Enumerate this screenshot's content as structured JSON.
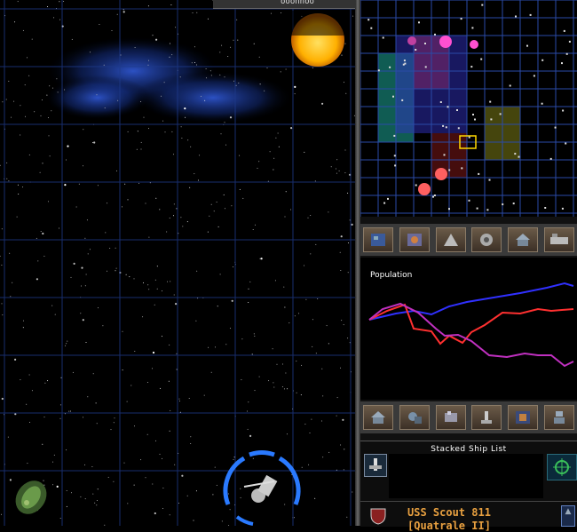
{
  "top_bar": {
    "clipped_text": "ooonnoo"
  },
  "graph": {
    "title": "Population"
  },
  "stack": {
    "title": "Stacked  Ship  List"
  },
  "ship": {
    "name": "USS Scout 811",
    "subtitle": "[Quatrale II]"
  },
  "toolbar_top": [
    "systems-icon",
    "planets-icon",
    "fleet-icon",
    "tech-icon",
    "home-icon",
    "options-icon"
  ],
  "toolbar_bottom": [
    "colony-icon",
    "troops-icon",
    "production-icon",
    "research-icon",
    "map-icon",
    "robot-icon"
  ],
  "colors": {
    "grid": "#1e3a8a",
    "population_blue": "#3030ff",
    "population_red": "#ff3030",
    "population_magenta": "#c030c0",
    "ship_text": "#e8a040"
  }
}
